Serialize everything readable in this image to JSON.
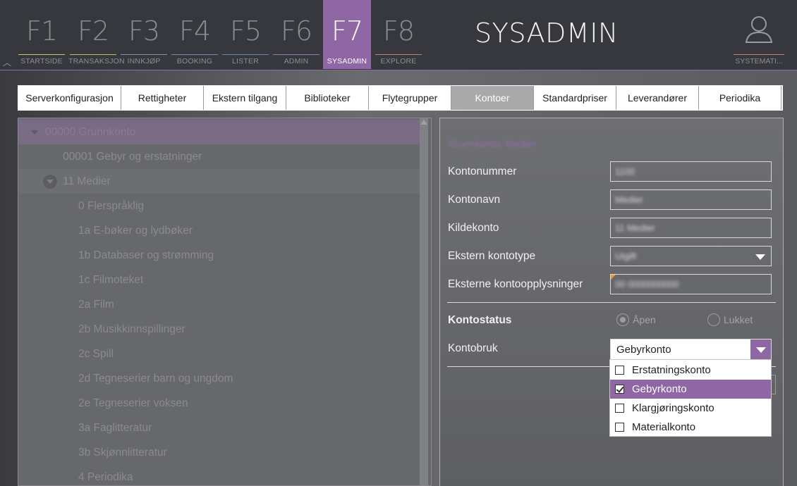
{
  "topbar": {
    "fkeys": [
      {
        "key": "F1",
        "label": "STARTSIDE",
        "color": "#c8c86a"
      },
      {
        "key": "F2",
        "label": "TRANSAKSJON",
        "color": "#b5c36a"
      },
      {
        "key": "F3",
        "label": "INNKJØP",
        "color": "#8a8ea8"
      },
      {
        "key": "F4",
        "label": "BOOKING",
        "color": "#7a8aa8"
      },
      {
        "key": "F5",
        "label": "LISTER",
        "color": "#6b86a8"
      },
      {
        "key": "F6",
        "label": "ADMIN",
        "color": "#9a7aa8"
      },
      {
        "key": "F7",
        "label": "SYSADMIN",
        "color": "#8f67a5"
      },
      {
        "key": "F8",
        "label": "EXPLORE",
        "color": "#c47b7b"
      }
    ],
    "active_key": "F7",
    "app_title": "SYSADMIN",
    "user_label": "SYSTEMATI..."
  },
  "tabs": [
    "Serverkonfigurasjon",
    "Rettigheter",
    "Ekstern tilgang",
    "Biblioteker",
    "Flytegrupper",
    "Kontoer",
    "Standardpriser",
    "Leverandører",
    "Periodika"
  ],
  "active_tab": "Kontoer",
  "tree": {
    "items": [
      {
        "label": "00000 Grunnkonto"
      },
      {
        "label": "00001 Gebyr og erstatninger"
      },
      {
        "label": "11 Medier"
      },
      {
        "label": "0 Flerspråklig"
      },
      {
        "label": "1a E-bøker og lydbøker"
      },
      {
        "label": "1b Databaser og strømming"
      },
      {
        "label": "1c Filmoteket"
      },
      {
        "label": "2a Film"
      },
      {
        "label": "2b Musikkinnspillinger"
      },
      {
        "label": "2c Spill"
      },
      {
        "label": "2d Tegneserier barn og ungdom"
      },
      {
        "label": "2e Tegneserier voksen"
      },
      {
        "label": "3a Faglitteratur"
      },
      {
        "label": "3b Skjønnlitteratur"
      },
      {
        "label": "4 Periodika"
      }
    ]
  },
  "form": {
    "heading": "Grunnkonto, Medier",
    "labels": {
      "kontonummer": "Kontonummer",
      "kontonavn": "Kontonavn",
      "kildekonto": "Kildekonto",
      "ekstern_kontotype": "Ekstern kontotype",
      "eksterne_opplysninger": "Eksterne kontoopplysninger",
      "kontostatus": "Kontostatus",
      "kontobruk": "Kontobruk"
    },
    "values": {
      "kontonummer": "1100",
      "kontonavn": "Medier",
      "kildekonto": "11 Medier",
      "ekstern_kontotype": "Utgift",
      "eksterne_opplysninger": "00 0000000000"
    },
    "radio": {
      "open": "Åpen",
      "closed": "Lukket"
    },
    "kontobruk_value": "Gebyrkonto"
  },
  "dropdown": {
    "options": [
      "Erstatningskonto",
      "Gebyrkonto",
      "Klargjøringskonto",
      "Materialkonto"
    ],
    "checked": "Gebyrkonto"
  },
  "colors": {
    "accent": "#8f67a5"
  }
}
